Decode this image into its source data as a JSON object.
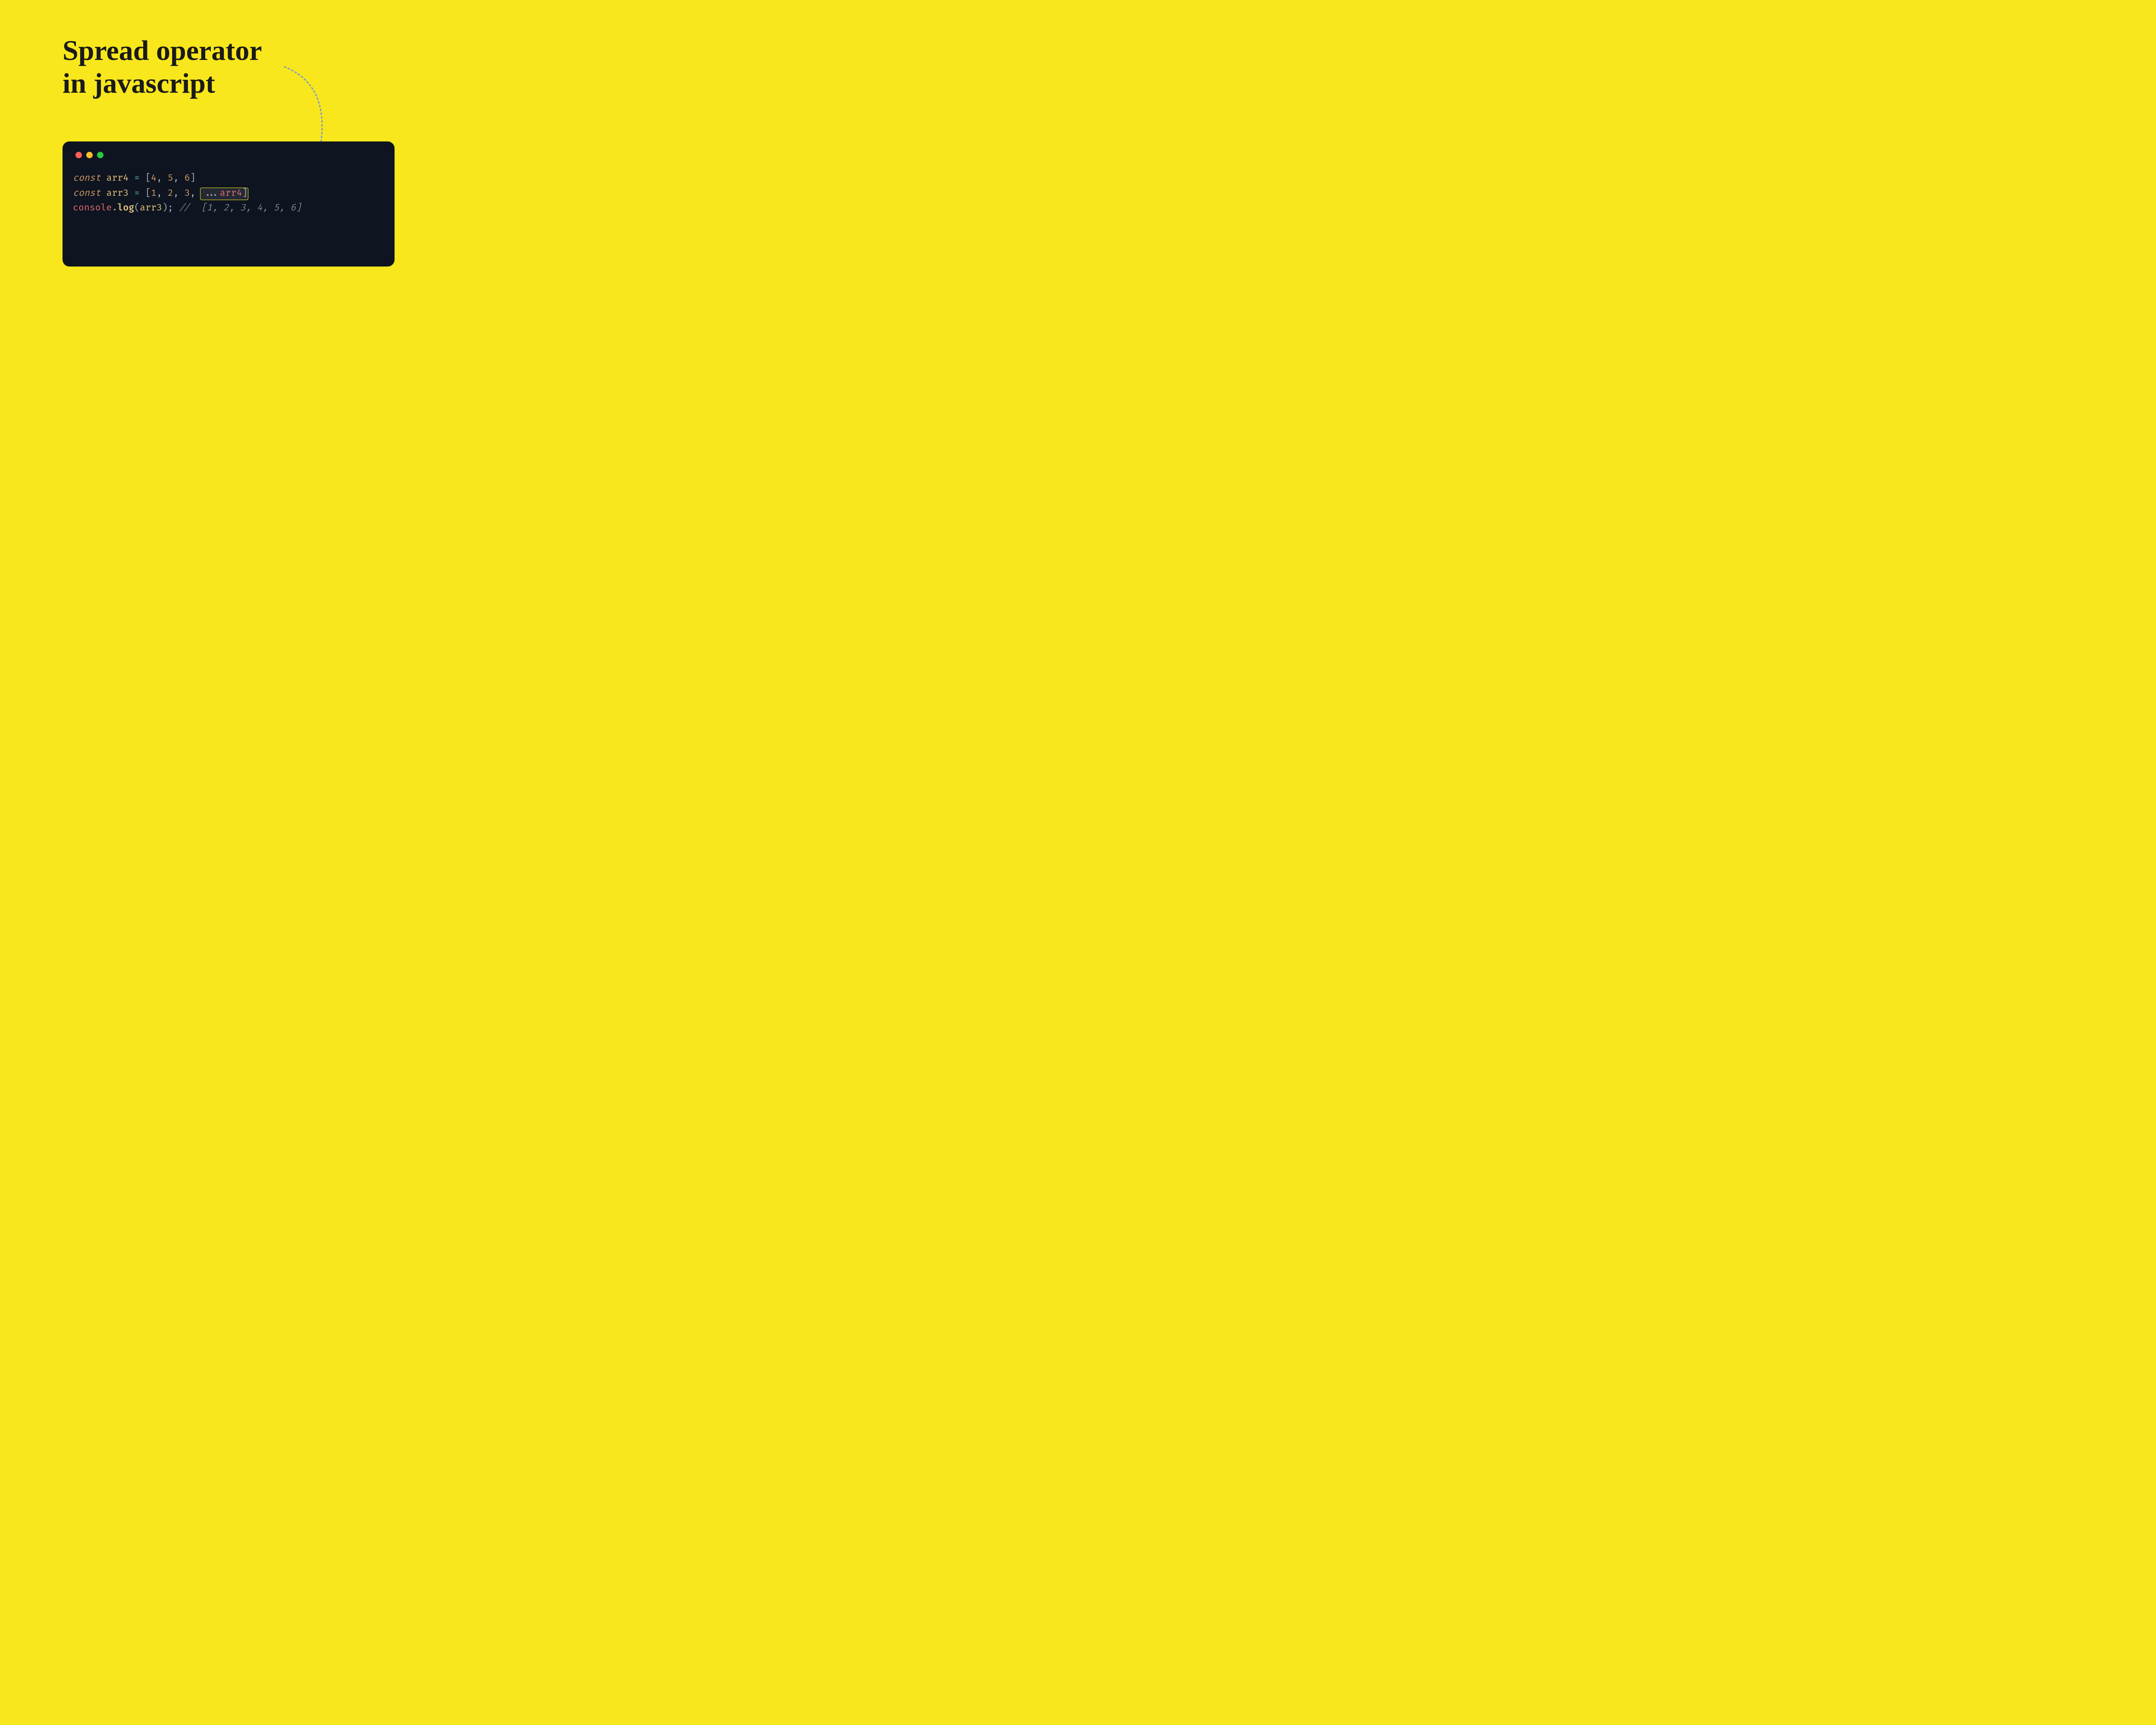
{
  "title_line1": "Spread operator",
  "title_line2": "in javascript",
  "code": {
    "line1": {
      "kw": "const",
      "var": "arr4",
      "eq": "=",
      "lb": "[",
      "n1": "4",
      "c1": ",",
      "n2": "5",
      "c2": ",",
      "n3": "6",
      "rb": "]"
    },
    "line2": {
      "kw": "const",
      "var": "arr3",
      "eq": "=",
      "lb": "[",
      "n1": "1",
      "c1": ",",
      "n2": "2",
      "c2": ",",
      "n3": "3",
      "c3": ",",
      "spread": "...",
      "spreadvar": "arr4",
      "rb": "]"
    },
    "line3": {
      "obj": "console",
      "dot": ".",
      "method": "log",
      "lp": "(",
      "arg": "arr3",
      "rp": ")",
      "semi": ";",
      "comment": "//  [1, 2, 3, 4, 5, 6]"
    }
  }
}
